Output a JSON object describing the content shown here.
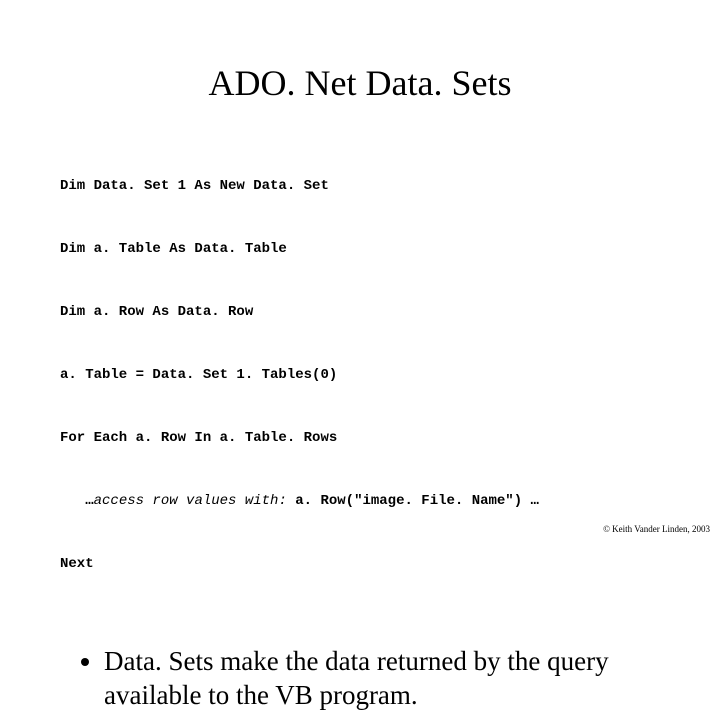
{
  "title": "ADO. Net Data. Sets",
  "code": {
    "l1": "Dim Data. Set 1 As New Data. Set",
    "l2": "Dim a. Table As Data. Table",
    "l3": "Dim a. Row As Data. Row",
    "l4": "a. Table = Data. Set 1. Tables(0)",
    "l5": "For Each a. Row In a. Table. Rows",
    "l6_prefix": "   …",
    "l6_italic": "access row values with: ",
    "l6_suffix": "a. Row(\"image. File. Name\") …",
    "l7": "Next"
  },
  "bullet1": "Data. Sets make the data returned by the query available to the VB program.",
  "copyright": "© Keith Vander Linden, 2003"
}
